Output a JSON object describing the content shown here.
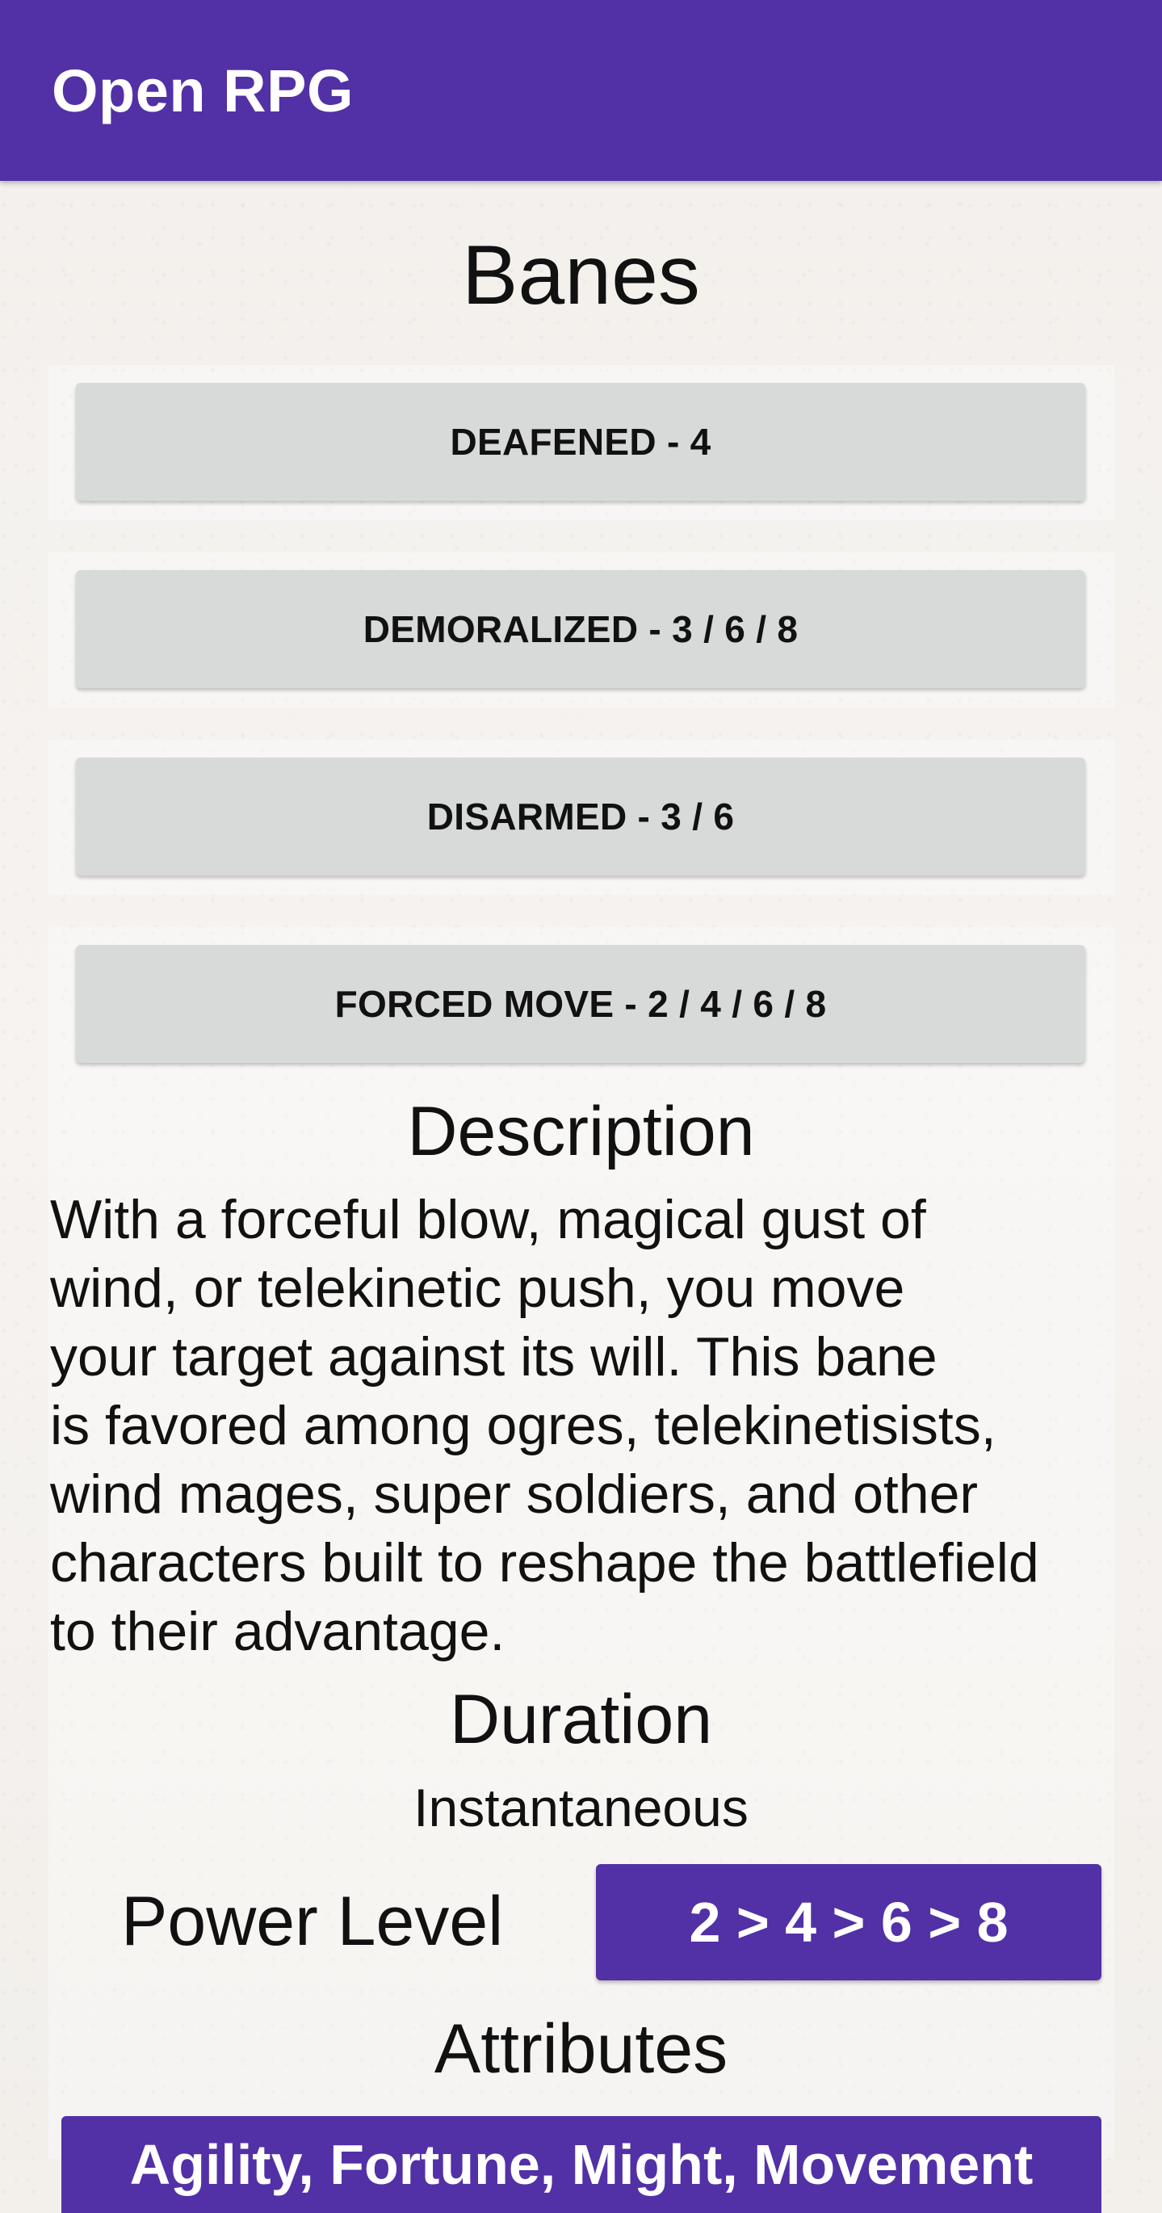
{
  "app": {
    "title": "Open RPG"
  },
  "page": {
    "title": "Banes"
  },
  "banes": [
    {
      "label": "DEAFENED - 4"
    },
    {
      "label": "DEMORALIZED - 3 / 6 / 8"
    },
    {
      "label": "DISARMED - 3 / 6"
    },
    {
      "label": "FORCED MOVE - 2 / 4 / 6 / 8"
    }
  ],
  "description": {
    "heading": "Description",
    "lines": [
      "With a forceful blow, magical gust of",
      "wind, or telekinetic push, you move",
      "your target against its will. This bane",
      "is favored among ogres, telekinetisists,",
      "wind mages, super soldiers, and other",
      "characters built to reshape the battlefield",
      "to their advantage."
    ]
  },
  "duration": {
    "heading": "Duration",
    "value": "Instantaneous"
  },
  "power_level": {
    "label": "Power Level",
    "value": "2 > 4 > 6 > 8"
  },
  "attributes": {
    "heading": "Attributes",
    "first_button": "Agility, Fortune, Might, Movement"
  },
  "colors": {
    "appbar": "#5230a6",
    "bane_button": "#d8d9d9",
    "accent_button": "#5230a6"
  }
}
